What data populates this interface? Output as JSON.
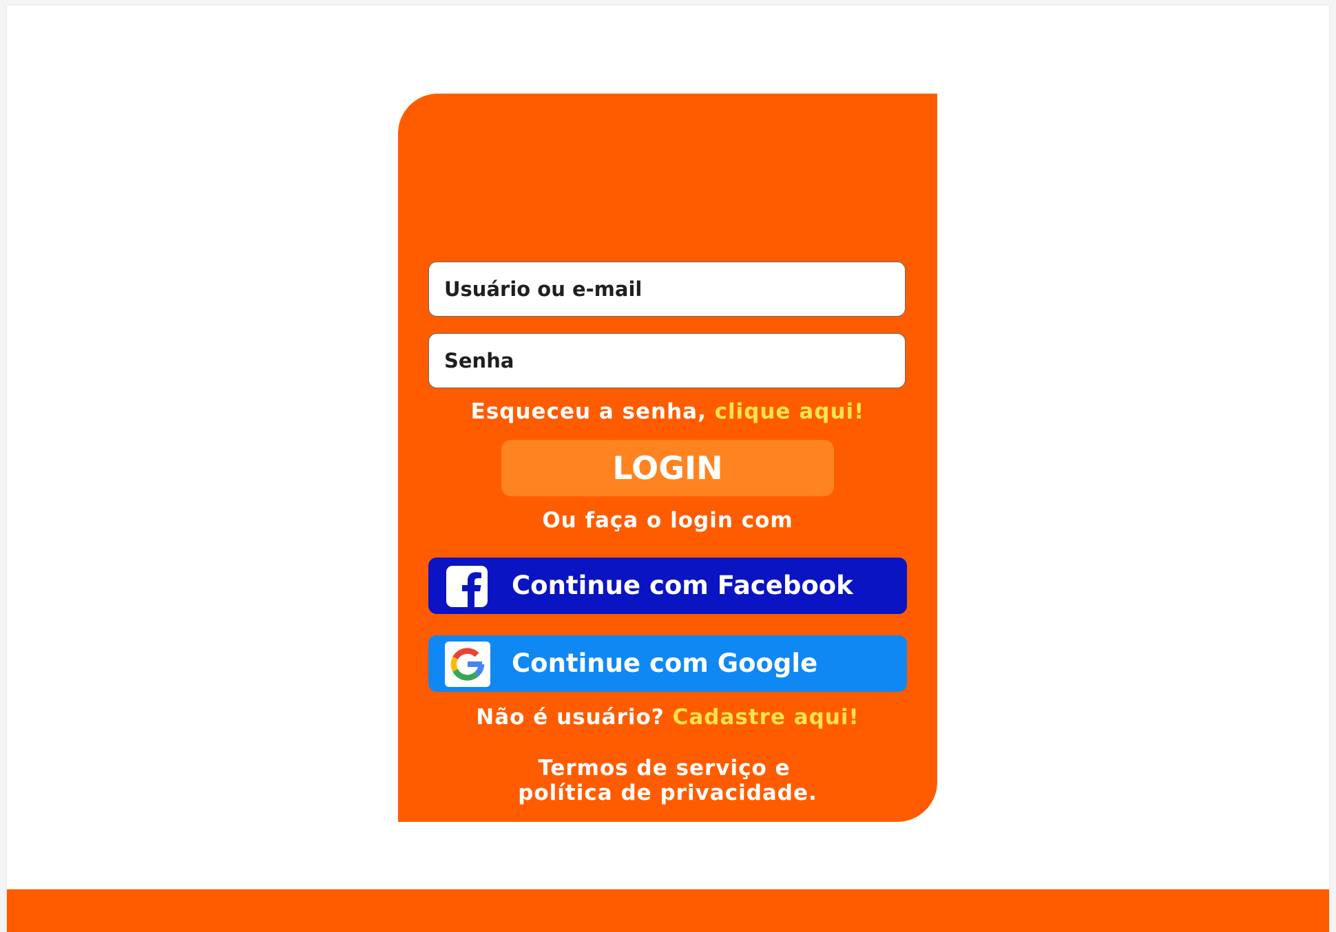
{
  "login": {
    "username_placeholder": "Usuário ou e-mail",
    "password_placeholder": "Senha",
    "forgot_text": "Esqueceu a senha, ",
    "forgot_link": "clique aqui!",
    "login_button": "LOGIN",
    "alt_login_text": "Ou faça o login com",
    "facebook_button": "Continue com Facebook",
    "google_button": "Continue com Google",
    "signup_text": "Não é usuário? ",
    "signup_link": "Cadastre aqui!",
    "terms_line1": "Termos de serviço e",
    "terms_line2": "política de privacidade."
  },
  "icons": {
    "facebook": "facebook-icon",
    "google": "google-icon"
  },
  "colors": {
    "brand_orange": "#ff5c00",
    "login_button": "#ff8320",
    "link_accent": "#ffe34a",
    "facebook_blue": "#0b14c2",
    "google_blue": "#1088f4"
  }
}
